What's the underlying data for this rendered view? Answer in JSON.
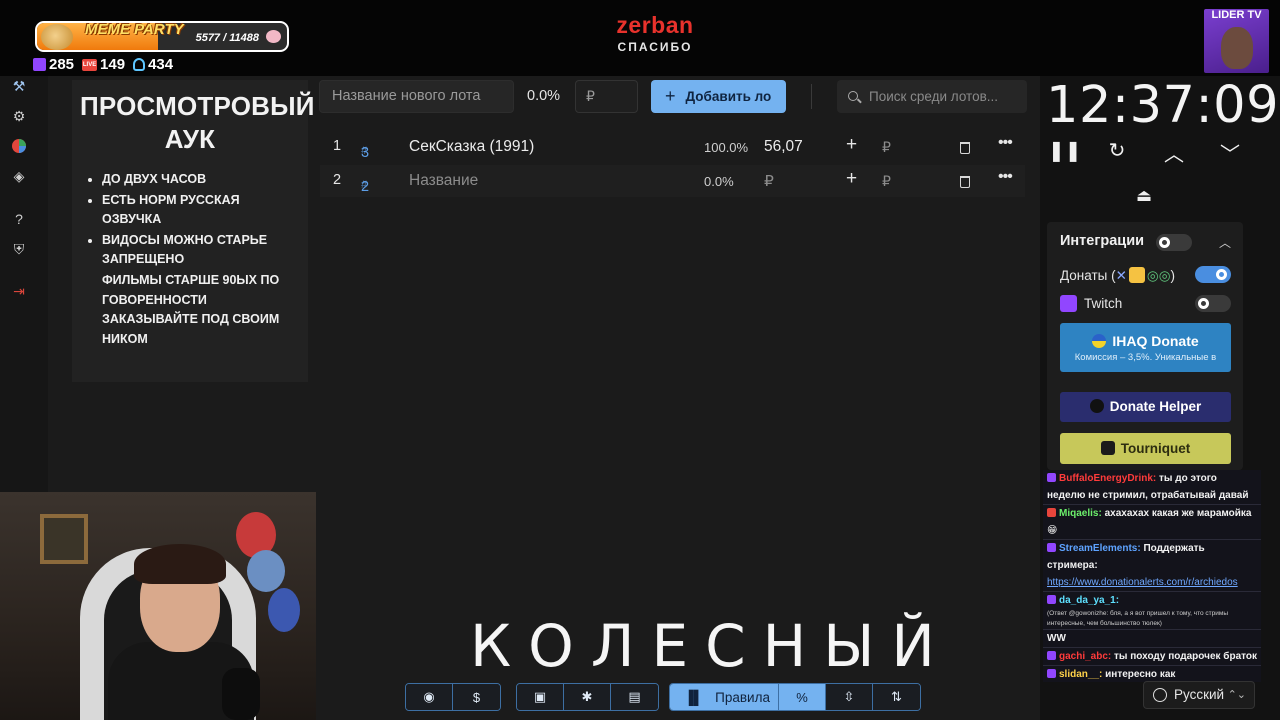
{
  "overlay": {
    "meme_title": "MEME PARTY",
    "meme_count": "5577 / 11488",
    "meme_progress": 0.4855,
    "twitch_viewers": "285",
    "live_viewers": "149",
    "user_count": "434",
    "brand_name": "zerban",
    "brand_sub": "СПАСИБО",
    "channel_badge": "LIDER TV",
    "caption": "КОЛЕСНЫЙ"
  },
  "rules": {
    "title": "ПРОСМОТРОВЫЙ АУК",
    "items": [
      "ДО ДВУХ ЧАСОВ",
      "ЕСТЬ НОРМ РУССКАЯ ОЗВУЧКА",
      "ВИДОСЫ МОЖНО СТАРЬЕ ЗАПРЕЩЕНО"
    ],
    "continuation": "ФИЛЬМЫ СТАРШЕ 90ЫХ ПО ГОВОРЕННОСТИ ЗАКАЗЫВАЙТЕ ПОД СВОИМ НИКОМ"
  },
  "toolbar": {
    "lot_name_placeholder": "Название нового лота",
    "percent": "0.0%",
    "currency_placeholder": "₽",
    "add_label": "Добавить ло",
    "search_placeholder": "Поиск среди лотов..."
  },
  "lots": [
    {
      "index": "1",
      "num": "3",
      "name": "СекСказка (1991)",
      "percent": "100.0%",
      "amount": "56,07",
      "currency": "₽"
    },
    {
      "index": "2",
      "num": "2",
      "name": "Название",
      "percent": "0.0%",
      "amount": "₽",
      "currency": "₽"
    }
  ],
  "timer": {
    "value": "12:37:09"
  },
  "integrations": {
    "title": "Интеграции",
    "donations_label": "Донаты (",
    "donations_close": ")",
    "donations_enabled": true,
    "twitch_label": "Twitch",
    "twitch_enabled": false,
    "ihaq_label": "IHAQ Donate",
    "ihaq_sub": "Комиссия – 3,5%. Уникальные в",
    "helper_label": "Donate Helper",
    "tourniquet_label": "Tourniquet"
  },
  "chat": [
    {
      "user": "BuffaloEnergyDrink:",
      "text": "ты до этого неделю не стримил, отрабатывай давай",
      "color": "red"
    },
    {
      "user": "Miqaelis:",
      "text": "ахахахах какая же марамойка😁",
      "color": "green"
    },
    {
      "user": "StreamElements:",
      "text": "Поддержать стримера:",
      "link": "https://www.donationalerts.com/r/archiedos",
      "color": "blue"
    },
    {
      "user": "da_da_ya_1:",
      "text": "",
      "color": "cyan"
    },
    {
      "user": "",
      "text": "(Ответ @gowonizhe: бля, а я вот пришел к тому, что стримы интересные, чем большинство тюлек)",
      "small": true
    },
    {
      "user": "",
      "text": "WW"
    },
    {
      "user": "gachi_abc:",
      "text": "ты походу подарочек браток",
      "color": "red"
    },
    {
      "user": "slidan__:",
      "text": "интересно как",
      "color": "yellow"
    }
  ],
  "language": "Русский",
  "bottom": {
    "rules_label": "Правила",
    "percent_label": "%",
    "dollar_label": "$"
  }
}
